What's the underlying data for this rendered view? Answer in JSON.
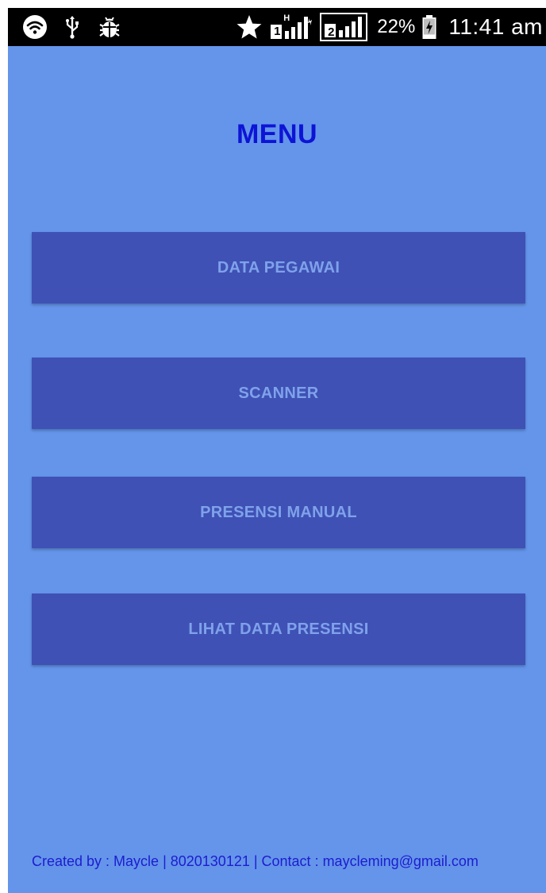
{
  "status_bar": {
    "battery_percent": "22%",
    "time": "11:41 am",
    "sim1_label": "1",
    "sim2_label": "2",
    "network_type": "H",
    "icons": [
      "wifi-icon",
      "usb-icon",
      "debug-bug-icon",
      "star-icon",
      "sim1-signal-icon",
      "sim2-signal-icon",
      "battery-charging-icon"
    ]
  },
  "menu": {
    "title": "MENU",
    "buttons": [
      {
        "label": "DATA PEGAWAI"
      },
      {
        "label": "SCANNER"
      },
      {
        "label": "PRESENSI MANUAL"
      },
      {
        "label": "LIHAT DATA PRESENSI"
      }
    ]
  },
  "footer": {
    "text": "Created by : Maycle | 8020130121 | Contact : maycleming@gmail.com"
  },
  "colors": {
    "background": "#6495ea",
    "button": "#3f51b5",
    "button_text": "#7fa2ea",
    "title": "#0d14d6",
    "footer_text": "#1d1dd0",
    "status_bar": "#000000"
  }
}
